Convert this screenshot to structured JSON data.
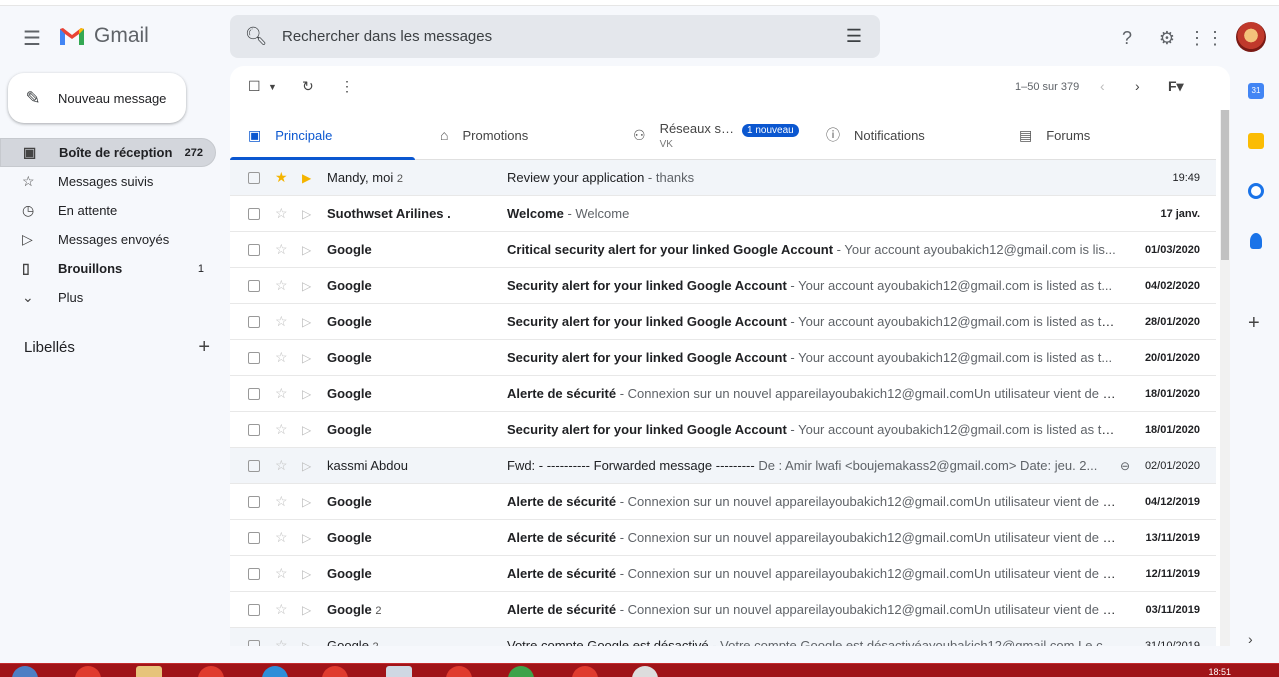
{
  "header": {
    "logo_text": "Gmail",
    "search_placeholder": "Rechercher dans les messages"
  },
  "sidebar": {
    "compose_label": "Nouveau message",
    "items": [
      {
        "label": "Boîte de réception",
        "count": "272",
        "icon": "inbox-icon"
      },
      {
        "label": "Messages suivis",
        "count": "",
        "icon": "star-icon"
      },
      {
        "label": "En attente",
        "count": "",
        "icon": "clock-icon"
      },
      {
        "label": "Messages envoyés",
        "count": "",
        "icon": "send-icon"
      },
      {
        "label": "Brouillons",
        "count": "1",
        "icon": "draft-icon"
      },
      {
        "label": "Plus",
        "count": "",
        "icon": "chevron-down-icon"
      }
    ],
    "labels_title": "Libellés"
  },
  "toolbar": {
    "pagination": "1–50 sur 379"
  },
  "tabs": [
    {
      "label": "Principale",
      "icon": "inbox-icon"
    },
    {
      "label": "Promotions",
      "icon": "tag-icon"
    },
    {
      "label": "Réseaux s…",
      "badge": "1 nouveau",
      "sub": "VK",
      "icon": "people-icon"
    },
    {
      "label": "Notifications",
      "icon": "info-icon"
    },
    {
      "label": "Forums",
      "icon": "forum-icon"
    }
  ],
  "emails": [
    {
      "sender": "Mandy, moi",
      "count": "2",
      "title": "Review your application",
      "snippet": " - thanks",
      "date": "19:49",
      "unread": false,
      "starred": true,
      "important": true
    },
    {
      "sender": "Suothwset Arilines .",
      "count": "",
      "title": "Welcome",
      "snippet": " - Welcome",
      "date": "17 janv.",
      "unread": true,
      "starred": false,
      "important": false
    },
    {
      "sender": "Google",
      "count": "",
      "title": "Critical security alert for your linked Google Account",
      "snippet": " - Your account ayoubakich12@gmail.com is lis...",
      "date": "01/03/2020",
      "unread": true,
      "starred": false,
      "important": false
    },
    {
      "sender": "Google",
      "count": "",
      "title": "Security alert for your linked Google Account",
      "snippet": " - Your account ayoubakich12@gmail.com is listed as t...",
      "date": "04/02/2020",
      "unread": true,
      "starred": false,
      "important": false
    },
    {
      "sender": "Google",
      "count": "",
      "title": "Security alert for your linked Google Account",
      "snippet": " - Your account ayoubakich12@gmail.com is listed as th...",
      "date": "28/01/2020",
      "unread": true,
      "starred": false,
      "important": false
    },
    {
      "sender": "Google",
      "count": "",
      "title": "Security alert for your linked Google Account",
      "snippet": " - Your account ayoubakich12@gmail.com is listed as t...",
      "date": "20/01/2020",
      "unread": true,
      "starred": false,
      "important": false
    },
    {
      "sender": "Google",
      "count": "",
      "title": "Alerte de sécurité",
      "snippet": " - Connexion sur un nouvel appareilayoubakich12@gmail.comUn utilisateur vient de s...",
      "date": "18/01/2020",
      "unread": true,
      "starred": false,
      "important": false
    },
    {
      "sender": "Google",
      "count": "",
      "title": "Security alert for your linked Google Account",
      "snippet": " - Your account ayoubakich12@gmail.com is listed as th...",
      "date": "18/01/2020",
      "unread": true,
      "starred": false,
      "important": false
    },
    {
      "sender": "kassmi Abdou",
      "count": "",
      "title": "Fwd: - ---------- Forwarded message ---------",
      "snippet": " De : Amir lwafi <boujemakass2@gmail.com> Date: jeu. 2...",
      "date": "02/01/2020",
      "unread": false,
      "starred": false,
      "important": false,
      "attachment": true
    },
    {
      "sender": "Google",
      "count": "",
      "title": "Alerte de sécurité",
      "snippet": " - Connexion sur un nouvel appareilayoubakich12@gmail.comUn utilisateur vient de s...",
      "date": "04/12/2019",
      "unread": true,
      "starred": false,
      "important": false
    },
    {
      "sender": "Google",
      "count": "",
      "title": "Alerte de sécurité",
      "snippet": " - Connexion sur un nouvel appareilayoubakich12@gmail.comUn utilisateur vient de se...",
      "date": "13/11/2019",
      "unread": true,
      "starred": false,
      "important": false
    },
    {
      "sender": "Google",
      "count": "",
      "title": "Alerte de sécurité",
      "snippet": " - Connexion sur un nouvel appareilayoubakich12@gmail.comUn utilisateur vient de se...",
      "date": "12/11/2019",
      "unread": true,
      "starred": false,
      "important": false
    },
    {
      "sender": "Google",
      "count": "2",
      "title": "Alerte de sécurité",
      "snippet": " - Connexion sur un nouvel appareilayoubakich12@gmail.comUn utilisateur vient de s...",
      "date": "03/11/2019",
      "unread": true,
      "starred": false,
      "important": false
    },
    {
      "sender": "Google",
      "count": "2",
      "title": "Votre compte Google est désactivé",
      "snippet": " - Votre compte Google est désactivéayoubakich12@gmail.com Le co...",
      "date": "31/10/2019",
      "unread": false,
      "starred": false,
      "important": false
    }
  ],
  "taskbar": {
    "clock": "18:51"
  },
  "colors": {
    "accent": "#0b57d0",
    "star": "#f4b400",
    "taskbar": "#a01418"
  }
}
